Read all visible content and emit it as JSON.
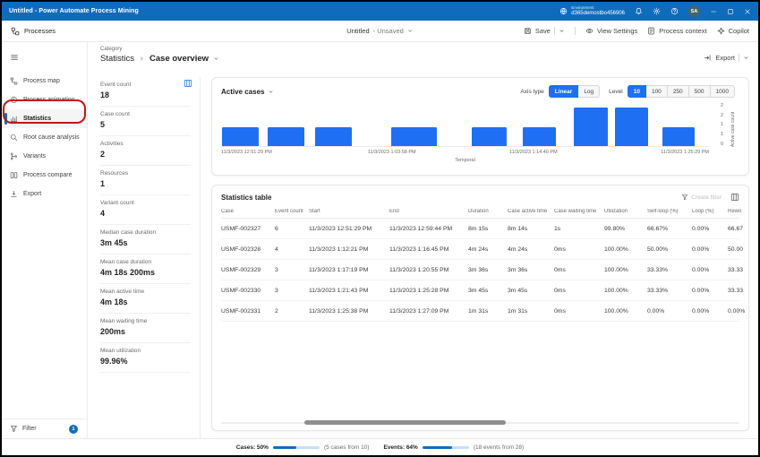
{
  "title_bar": {
    "title": "Untitled - Power Automate Process Mining",
    "environment_label": "Environment",
    "environment_name": "d365demostbo456906",
    "avatar_initials": "SA"
  },
  "command_bar": {
    "processes_label": "Processes",
    "doc_title": "Untitled",
    "doc_state": "- Unsaved",
    "save_label": "Save",
    "view_settings_label": "View Settings",
    "process_context_label": "Process context",
    "copilot_label": "Copilot"
  },
  "sidebar": {
    "items": [
      {
        "label": "Process map",
        "icon": "process-map",
        "selected": false
      },
      {
        "label": "Process animation",
        "icon": "process-animation",
        "selected": false
      },
      {
        "label": "Statistics",
        "icon": "statistics",
        "selected": true
      },
      {
        "label": "Root cause analysis",
        "icon": "root-cause",
        "selected": false
      },
      {
        "label": "Variants",
        "icon": "variants",
        "selected": false
      },
      {
        "label": "Process compare",
        "icon": "process-compare",
        "selected": false
      },
      {
        "label": "Export",
        "icon": "export",
        "selected": false
      }
    ],
    "filter_label": "Filter",
    "filter_badge": "1"
  },
  "annotation": {
    "target": "sidebar-item-statistics",
    "highlight_color": "#c0161d"
  },
  "content_header": {
    "category_label": "Category",
    "breadcrumb_root": "Statistics",
    "breadcrumb_current": "Case overview",
    "export_label": "Export"
  },
  "stats_panel": {
    "items": [
      {
        "label": "Event count",
        "value": "18"
      },
      {
        "label": "Case count",
        "value": "5"
      },
      {
        "label": "Activities",
        "value": "2"
      },
      {
        "label": "Resources",
        "value": "1"
      },
      {
        "label": "Variant count",
        "value": "4"
      },
      {
        "label": "Median case duration",
        "value": "3m 45s"
      },
      {
        "label": "Mean case duration",
        "value": "4m 18s 200ms"
      },
      {
        "label": "Mean active time",
        "value": "4m 18s"
      },
      {
        "label": "Mean waiting time",
        "value": "200ms"
      },
      {
        "label": "Mean utilization",
        "value": "99.96%"
      }
    ]
  },
  "chart_panel": {
    "title": "Active cases",
    "axis_type_label": "Axis type",
    "axis_options": [
      "Linear",
      "Log"
    ],
    "axis_selected": "Linear",
    "level_label": "Level",
    "level_options": [
      "10",
      "100",
      "250",
      "500",
      "1000"
    ],
    "level_selected": "10",
    "accent_color": "#1f6ff2"
  },
  "chart_data": {
    "type": "bar",
    "title": "Active cases",
    "xlabel": "Temporal",
    "ylabel": "Active case count",
    "ylim": [
      0,
      2.2
    ],
    "y_tick_labels_top_to_bottom": [
      "2",
      "2",
      "1",
      "1",
      "0"
    ],
    "x_ticks": [
      {
        "label": "11/3/2023 12:51:29 PM",
        "pos": 0
      },
      {
        "label": "11/3/2023 1:03:58 PM",
        "pos": 0.35
      },
      {
        "label": "11/3/2023 1:14:40 PM",
        "pos": 0.64
      },
      {
        "label": "11/3/2023 1:25:29 PM",
        "pos": 1
      }
    ],
    "bars": [
      {
        "pos": 0.002,
        "width": 0.075,
        "value": 1
      },
      {
        "pos": 0.095,
        "width": 0.075,
        "value": 1
      },
      {
        "pos": 0.192,
        "width": 0.075,
        "value": 1
      },
      {
        "pos": 0.348,
        "width": 0.095,
        "value": 1
      },
      {
        "pos": 0.513,
        "width": 0.072,
        "value": 1
      },
      {
        "pos": 0.618,
        "width": 0.068,
        "value": 1
      },
      {
        "pos": 0.723,
        "width": 0.07,
        "value": 2
      },
      {
        "pos": 0.808,
        "width": 0.068,
        "value": 2
      },
      {
        "pos": 0.905,
        "width": 0.065,
        "value": 1
      }
    ],
    "bar_color": "#1f6ff2"
  },
  "table_panel": {
    "title": "Statistics table",
    "create_filter_label": "Create filter",
    "columns": [
      "Case",
      "Event count",
      "Start",
      "End",
      "Duration",
      "Case active time",
      "Case waiting time",
      "Utilization",
      "Self-loop (%)",
      "Loop (%)",
      "Rewo"
    ],
    "rows": [
      [
        "USMF-002327",
        "6",
        "11/3/2023 12:51:29 PM",
        "11/3/2023 12:59:44 PM",
        "8m 15s",
        "8m 14s",
        "1s",
        "99.80%",
        "66.67%",
        "0.00%",
        "66.67"
      ],
      [
        "USMF-002328",
        "4",
        "11/3/2023 1:12:21 PM",
        "11/3/2023 1:16:45 PM",
        "4m 24s",
        "4m 24s",
        "0ms",
        "100.00%",
        "50.00%",
        "0.00%",
        "50.00"
      ],
      [
        "USMF-002329",
        "3",
        "11/3/2023 1:17:19 PM",
        "11/3/2023 1:20:55 PM",
        "3m 36s",
        "3m 36s",
        "0ms",
        "100.00%",
        "33.33%",
        "0.00%",
        "33.33"
      ],
      [
        "USMF-002330",
        "3",
        "11/3/2023 1:21:43 PM",
        "11/3/2023 1:25:28 PM",
        "3m 45s",
        "3m 45s",
        "0ms",
        "100.00%",
        "33.33%",
        "0.00%",
        "33.33"
      ],
      [
        "USMF-002331",
        "2",
        "11/3/2023 1:25:38 PM",
        "11/3/2023 1:27:09 PM",
        "1m 31s",
        "1m 31s",
        "0ms",
        "100.00%",
        "0.00%",
        "0.00%",
        "0.00%"
      ]
    ]
  },
  "status_bar": {
    "cases_label": "Cases: 50%",
    "cases_percent": 50,
    "cases_detail": "(5 cases from 10)",
    "events_label": "Events: 64%",
    "events_percent": 64,
    "events_detail": "(18 events from 28)"
  }
}
